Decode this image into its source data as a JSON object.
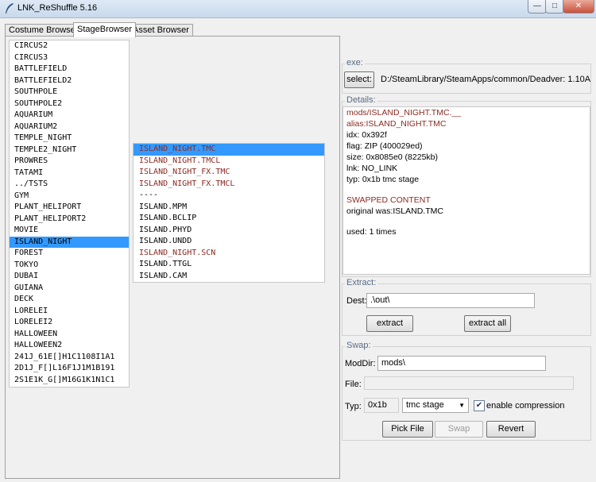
{
  "window": {
    "title": "LNK_ReShuffle 5.16"
  },
  "tabs": [
    "Costume Browser",
    "StageBrowser",
    "Asset Browser"
  ],
  "stages": {
    "items": [
      "CIRCUS2",
      "CIRCUS3",
      "BATTLEFIELD",
      "BATTLEFIELD2",
      "SOUTHPOLE",
      "SOUTHPOLE2",
      "AQUARIUM",
      "AQUARIUM2",
      "TEMPLE_NIGHT",
      "TEMPLE2_NIGHT",
      "PROWRES",
      "TATAMI",
      "../TSTS",
      "GYM",
      "PLANT_HELIPORT",
      "PLANT_HELIPORT2",
      "MOVIE",
      "ISLAND_NIGHT",
      "FOREST",
      "TOKYO",
      "DUBAI",
      "GUIANA",
      "DECK",
      "LORELEI",
      "LORELEI2",
      "HALLOWEEN",
      "HALLOWEEN2",
      "241J_61E[]H1C1108I1A1",
      "2D1J_F[]L16F1J1M1B191",
      "2S1E1K_G[]M16G1K1N1C1"
    ],
    "selected": "ISLAND_NIGHT"
  },
  "files": {
    "items": [
      {
        "name": "ISLAND_NIGHT.TMC",
        "swapped": true
      },
      {
        "name": "ISLAND_NIGHT.TMCL",
        "swapped": true
      },
      {
        "name": "ISLAND_NIGHT_FX.TMC",
        "swapped": true
      },
      {
        "name": "ISLAND_NIGHT_FX.TMCL",
        "swapped": true
      },
      {
        "name": "----",
        "swapped": false
      },
      {
        "name": "ISLAND.MPM",
        "swapped": false
      },
      {
        "name": "ISLAND.BCLIP",
        "swapped": false
      },
      {
        "name": "ISLAND.PHYD",
        "swapped": false
      },
      {
        "name": "ISLAND.UNDD",
        "swapped": false
      },
      {
        "name": "ISLAND_NIGHT.SCN",
        "swapped": true
      },
      {
        "name": "ISLAND.TTGL",
        "swapped": false
      },
      {
        "name": "ISLAND.CAM",
        "swapped": false
      }
    ],
    "selected": "ISLAND_NIGHT.TMC"
  },
  "exe": {
    "label": "exe:",
    "select_label": "select:",
    "path": "D:/SteamLibrary/SteamApps/common/Dead",
    "version": "ver: 1.10A"
  },
  "details": {
    "label": "Details:",
    "lines": [
      {
        "text": "mods/ISLAND_NIGHT.TMC.__",
        "red": true
      },
      {
        "text": "alias:ISLAND_NIGHT.TMC",
        "red": true
      },
      {
        "text": " idx: 0x392f",
        "red": false
      },
      {
        "text": "flag:  ZIP (400029ed)",
        "red": false
      },
      {
        "text": "size: 0x8085e0 (8225kb)",
        "red": false
      },
      {
        "text": " lnk: NO_LINK",
        "red": false
      },
      {
        "text": " typ: 0x1b tmc stage",
        "red": false
      },
      {
        "text": "",
        "red": false
      },
      {
        "text": "SWAPPED CONTENT",
        "red": true
      },
      {
        "text": " original was:ISLAND.TMC",
        "red": false
      },
      {
        "text": "",
        "red": false
      },
      {
        "text": "used: 1 times",
        "red": false
      }
    ]
  },
  "extract": {
    "label": "Extract:",
    "dest_label": "Dest:",
    "dest_value": ".\\out\\",
    "extract_button": "extract",
    "extract_all_button": "extract all"
  },
  "swap": {
    "label": "Swap:",
    "moddir_label": "ModDir:",
    "moddir_value": "mods\\",
    "file_label": "File:",
    "file_value": "",
    "typ_label": "Typ:",
    "typ_value": "0x1b",
    "typ_select": "tmc stage",
    "compression_label": "enable compression",
    "compression_checked": true,
    "pick_file_button": "Pick File",
    "swap_button": "Swap",
    "revert_button": "Revert"
  },
  "colors": {
    "selection": "#3399ff",
    "swapped_text": "#8b2a22"
  }
}
